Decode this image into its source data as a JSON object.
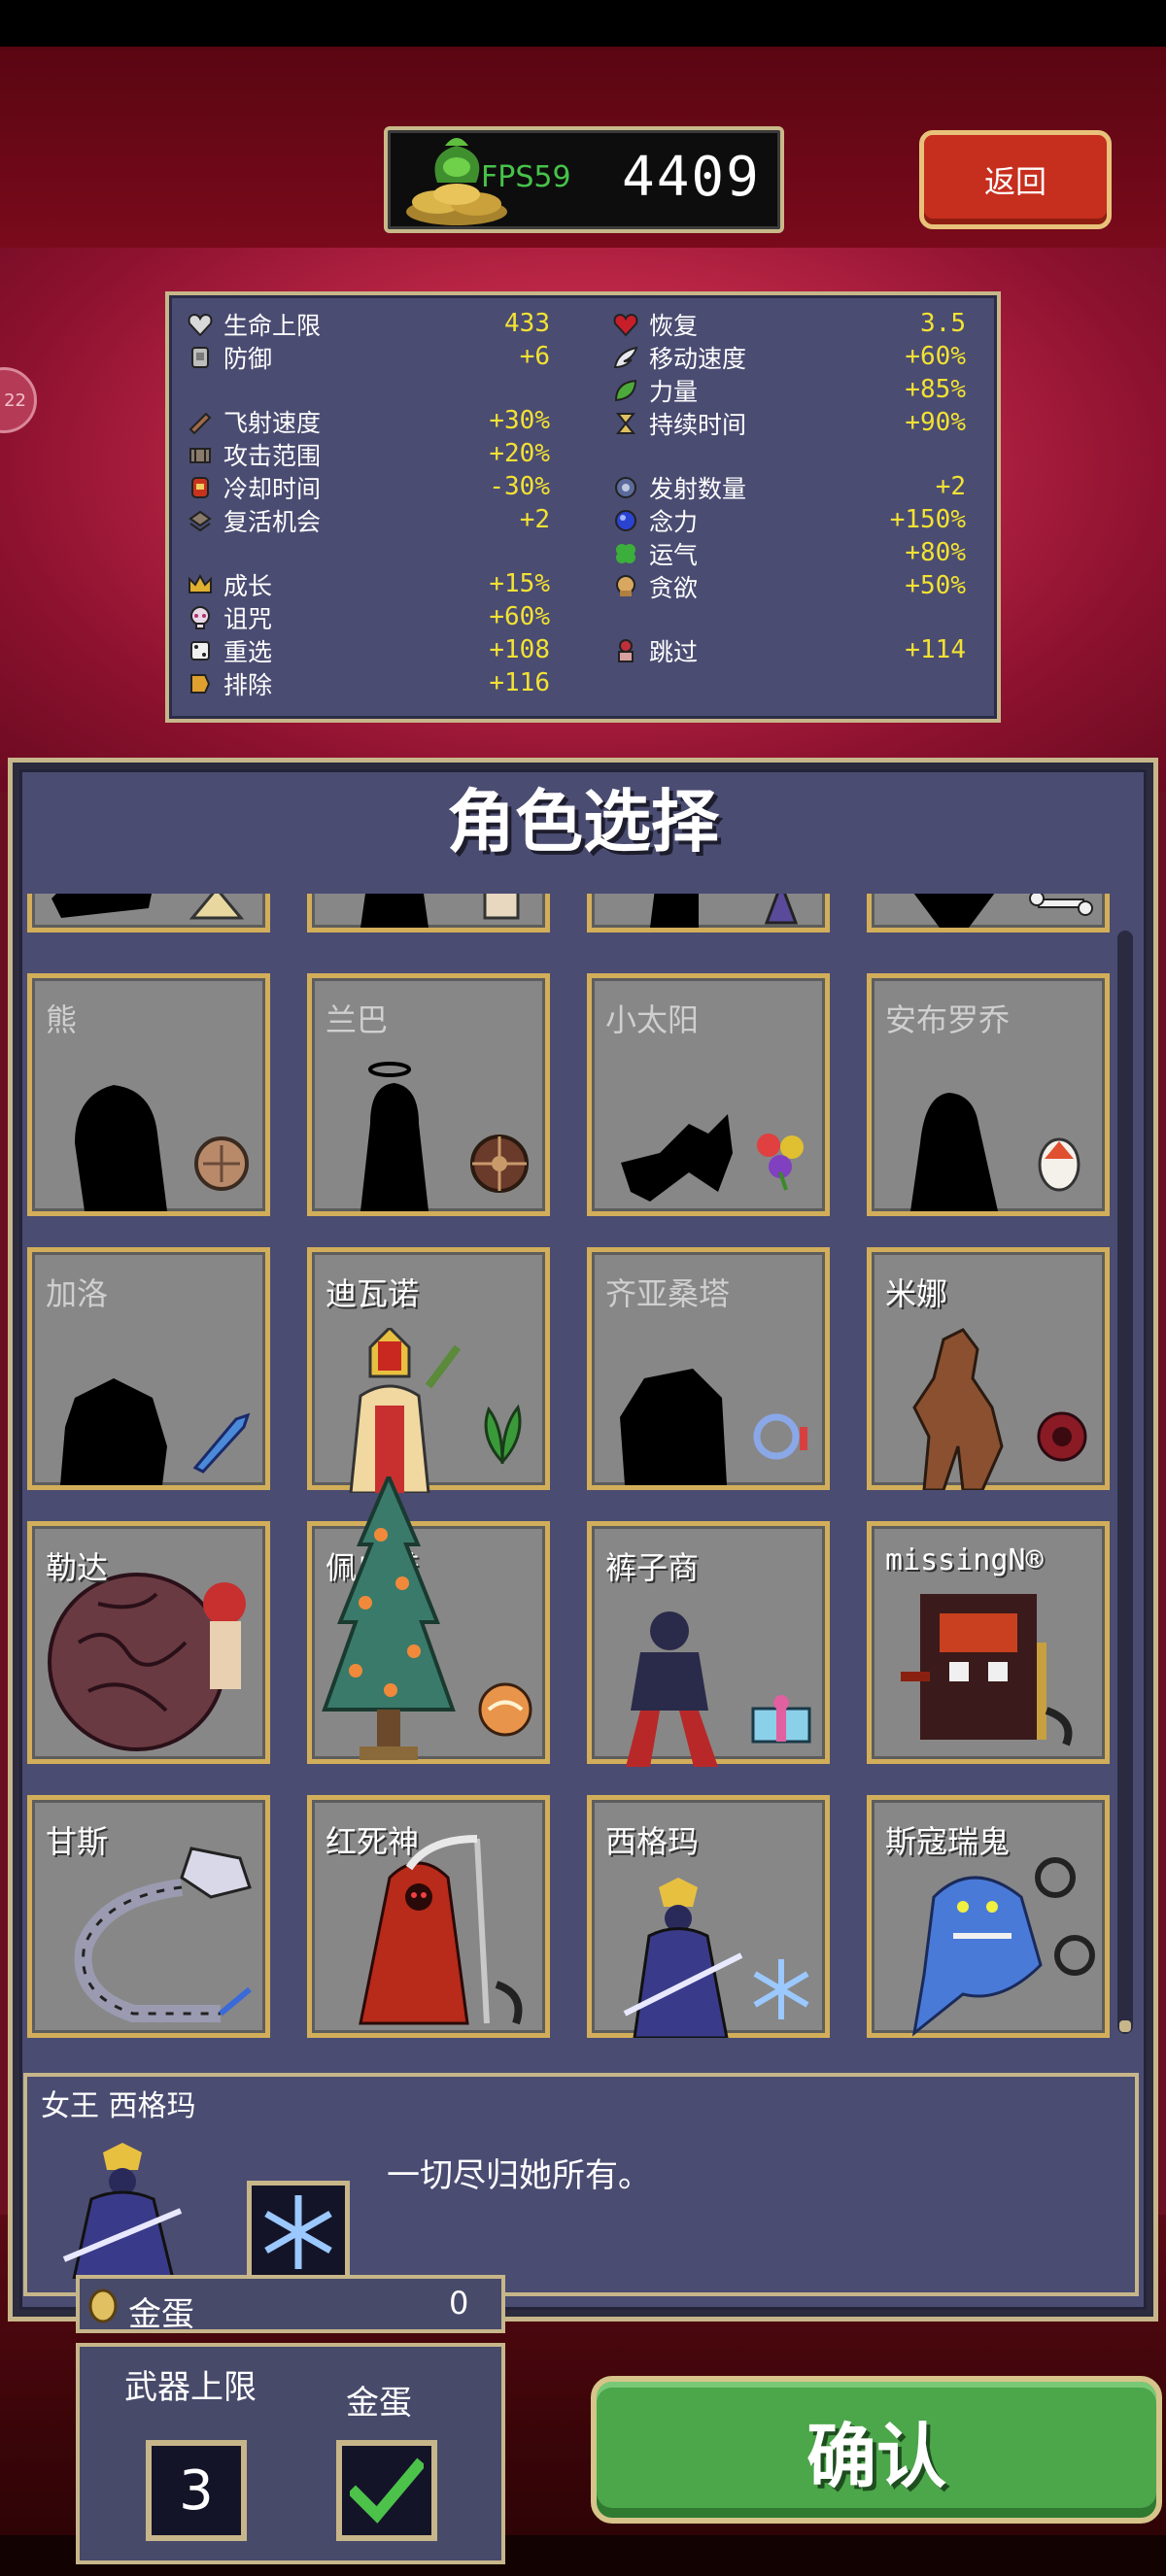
{
  "header": {
    "fps_label": "FPS59",
    "coin_value": "4409",
    "back_label": "返回",
    "side_badge": "22"
  },
  "stats": {
    "left": [
      {
        "label": "生命上限",
        "value": "433",
        "icon": "heart-icon"
      },
      {
        "label": "防御",
        "value": "+6",
        "icon": "armor-icon"
      },
      {
        "label": "飞射速度",
        "value": "+30%",
        "icon": "speed-icon"
      },
      {
        "label": "攻击范围",
        "value": "+20%",
        "icon": "area-icon"
      },
      {
        "label": "冷却时间",
        "value": "-30%",
        "icon": "cooldown-icon"
      },
      {
        "label": "复活机会",
        "value": "+2",
        "icon": "revival-icon"
      },
      {
        "label": "成长",
        "value": "+15%",
        "icon": "crown-icon"
      },
      {
        "label": "诅咒",
        "value": "+60%",
        "icon": "skull-icon"
      },
      {
        "label": "重选",
        "value": "+108",
        "icon": "dice-icon"
      },
      {
        "label": "排除",
        "value": "+116",
        "icon": "banish-icon"
      }
    ],
    "right": [
      {
        "label": "恢复",
        "value": "3.5",
        "icon": "recovery-icon"
      },
      {
        "label": "移动速度",
        "value": "+60%",
        "icon": "wing-icon"
      },
      {
        "label": "力量",
        "value": "+85%",
        "icon": "leaf-icon"
      },
      {
        "label": "持续时间",
        "value": "+90%",
        "icon": "hourglass-icon"
      },
      {
        "label": "发射数量",
        "value": "+2",
        "icon": "amount-icon"
      },
      {
        "label": "念力",
        "value": "+150%",
        "icon": "magnet-icon"
      },
      {
        "label": "运气",
        "value": "+80%",
        "icon": "clover-icon"
      },
      {
        "label": "贪欲",
        "value": "+50%",
        "icon": "greed-icon"
      },
      {
        "label": "跳过",
        "value": "+114",
        "icon": "skip-icon"
      }
    ]
  },
  "select": {
    "title": "角色选择",
    "characters": [
      {
        "name": "",
        "locked": true
      },
      {
        "name": "",
        "locked": true
      },
      {
        "name": "",
        "locked": true
      },
      {
        "name": "",
        "locked": true
      },
      {
        "name": "熊",
        "locked": true
      },
      {
        "name": "兰巴",
        "locked": true
      },
      {
        "name": "小太阳",
        "locked": true
      },
      {
        "name": "安布罗乔",
        "locked": true
      },
      {
        "name": "加洛",
        "locked": true
      },
      {
        "name": "迪瓦诺",
        "locked": false
      },
      {
        "name": "齐亚桑塔",
        "locked": true
      },
      {
        "name": "米娜",
        "locked": false
      },
      {
        "name": "勒达",
        "locked": false
      },
      {
        "name": "佩皮诺",
        "locked": false
      },
      {
        "name": "裤子商",
        "locked": false
      },
      {
        "name": "missingN®",
        "locked": false
      },
      {
        "name": "甘斯",
        "locked": false
      },
      {
        "name": "红死神",
        "locked": false
      },
      {
        "name": "西格玛",
        "locked": false
      },
      {
        "name": "斯寇瑞鬼",
        "locked": false
      }
    ]
  },
  "detail": {
    "title": "女王 西格玛",
    "description": "一切尽归她所有。"
  },
  "golden_egg": {
    "label": "金蛋",
    "count": "0"
  },
  "options": {
    "weapon_limit_label": "武器上限",
    "weapon_limit_value": "3",
    "golden_egg_label": "金蛋",
    "golden_egg_checked": true
  },
  "confirm_label": "确认",
  "colors": {
    "stat_value": "#f2e233",
    "panel": "#4b4c72",
    "gold_border": "#c7b68a",
    "confirm_green": "#4ca64a",
    "back_red": "#c62e1e"
  }
}
